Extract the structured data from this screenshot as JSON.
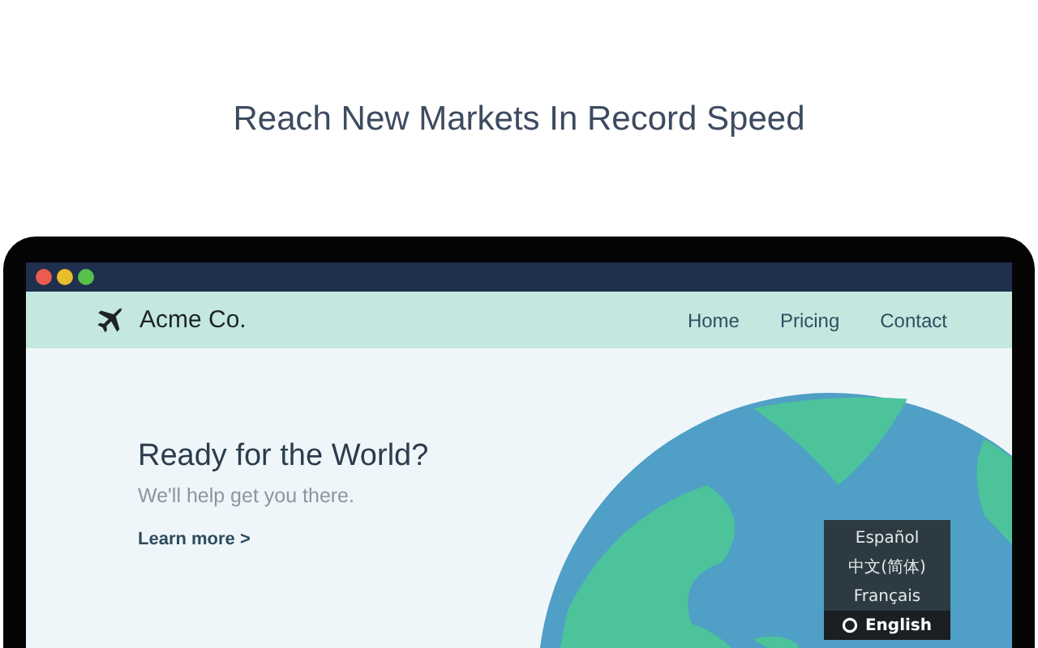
{
  "headline": "Reach New Markets In Record Speed",
  "site": {
    "logo": "Acme Co.",
    "nav": [
      {
        "label": "Home"
      },
      {
        "label": "Pricing"
      },
      {
        "label": "Contact"
      }
    ],
    "hero": {
      "title": "Ready for the World?",
      "subtitle": "We'll help get you there.",
      "link": "Learn more >"
    },
    "language_menu": [
      {
        "label": "Español",
        "selected": false
      },
      {
        "label": "中文(简体)",
        "selected": false
      },
      {
        "label": "Français",
        "selected": false
      },
      {
        "label": "English",
        "selected": true
      }
    ]
  }
}
